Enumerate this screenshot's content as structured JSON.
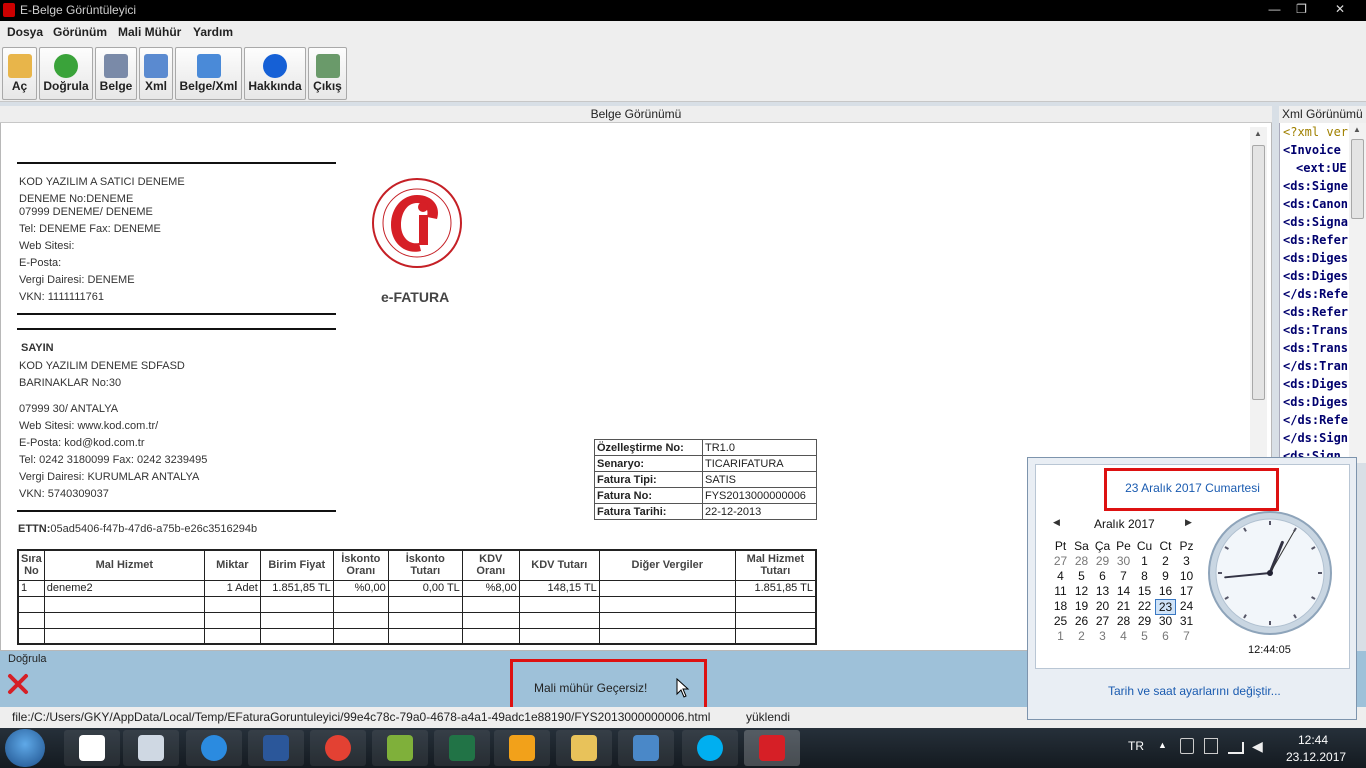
{
  "window": {
    "title": "E-Belge Görüntüleyici",
    "min": "—",
    "max": "❐",
    "close": "✕"
  },
  "menu": [
    "Dosya",
    "Görünüm",
    "Mali Mühür",
    "Yardım"
  ],
  "toolbar": [
    {
      "label": "Aç",
      "icon": "folder-icon",
      "color": "#e8b54a"
    },
    {
      "label": "Doğrula",
      "icon": "check-icon",
      "color": "#3aa33a"
    },
    {
      "label": "Belge",
      "icon": "document-icon",
      "color": "#7a8aa8"
    },
    {
      "label": "Xml",
      "icon": "xml-icon",
      "color": "#5a8ad0"
    },
    {
      "label": "Belge/Xml",
      "icon": "split-view-icon",
      "color": "#4a8ad8"
    },
    {
      "label": "Hakkında",
      "icon": "info-icon",
      "color": "#1560d6"
    },
    {
      "label": "Çıkış",
      "icon": "exit-icon",
      "color": "#6a9a6a"
    }
  ],
  "doc_panel": {
    "title": "Belge Görünümü"
  },
  "xml_panel": {
    "title": "Xml Görünümü",
    "lines": [
      "<?xml vers",
      "<Invoice",
      "<ext:UE",
      "<ds:Signe",
      "<ds:Canon",
      "<ds:Signa",
      "<ds:Refer",
      "<ds:Diges",
      "<ds:Diges",
      "</ds:Refe",
      "<ds:Refer",
      "<ds:Trans",
      "<ds:Trans",
      "</ds:Tran",
      "<ds:Diges",
      "<ds:Diges",
      "</ds:Refe",
      "</ds:Sign",
      "<ds:Sign"
    ]
  },
  "seller": {
    "name": "KOD YAZILIM A SATICI DENEME",
    "addr1": "DENEME  No:DENEME",
    "addr2": "07999 DENEME/ DENEME",
    "tel": "Tel: DENEME Fax: DENEME",
    "web": "Web Sitesi:",
    "email": "E-Posta:",
    "tax_office": "Vergi Dairesi: DENEME",
    "vkn": "VKN: 1111111761"
  },
  "logo_caption": "e-FATURA",
  "buyer": {
    "header": "SAYIN",
    "name": "KOD YAZILIM DENEME SDFASD",
    "addr1": "BARINAKLAR  No:30",
    "addr2": "07999 30/ ANTALYA",
    "web": "Web Sitesi: www.kod.com.tr/",
    "email": "E-Posta: kod@kod.com.tr",
    "tel": "Tel: 0242 3180099 Fax: 0242 3239495",
    "tax_office": "Vergi Dairesi: KURUMLAR ANTALYA",
    "vkn": "VKN: 5740309037"
  },
  "ettn": {
    "label": "ETTN:",
    "value": "05ad5406-f47b-47d6-a75b-e26c3516294b"
  },
  "invoice_info": [
    {
      "label": "Özelleştirme No:",
      "value": "TR1.0"
    },
    {
      "label": "Senaryo:",
      "value": "TICARIFATURA"
    },
    {
      "label": "Fatura Tipi:",
      "value": "SATIS"
    },
    {
      "label": "Fatura No:",
      "value": "FYS2013000000006"
    },
    {
      "label": "Fatura Tarihi:",
      "value": "22-12-2013"
    }
  ],
  "items_table": {
    "headers": [
      "Sıra No",
      "Mal Hizmet",
      "Miktar",
      "Birim Fiyat",
      "İskonto Oranı",
      "İskonto Tutarı",
      "KDV Oranı",
      "KDV Tutarı",
      "Diğer Vergiler",
      "Mal Hizmet Tutarı"
    ],
    "rows": [
      [
        "1",
        "deneme2",
        "1 Adet",
        "1.851,85 TL",
        "%0,00",
        "0,00 TL",
        "%8,00",
        "148,15 TL",
        "",
        "1.851,85 TL"
      ]
    ]
  },
  "status": {
    "label": "Doğrula",
    "message": "Mali mühür Geçersiz!"
  },
  "path": {
    "file": "file:/C:/Users/GKY/AppData/Local/Temp/EFaturaGoruntuleyici/99e4c78c-79a0-4678-a4a1-49adc1e88190/FYS2013000000006.html",
    "state": "yüklendi"
  },
  "calendar": {
    "date_full": "23 Aralık 2017 Cumartesi",
    "month": "Aralık 2017",
    "weekdays": [
      "Pt",
      "Sa",
      "Ça",
      "Pe",
      "Cu",
      "Ct",
      "Pz"
    ],
    "weeks": [
      [
        "27",
        "28",
        "29",
        "30",
        "1",
        "2",
        "3"
      ],
      [
        "4",
        "5",
        "6",
        "7",
        "8",
        "9",
        "10"
      ],
      [
        "11",
        "12",
        "13",
        "14",
        "15",
        "16",
        "17"
      ],
      [
        "18",
        "19",
        "20",
        "21",
        "22",
        "23",
        "24"
      ],
      [
        "25",
        "26",
        "27",
        "28",
        "29",
        "30",
        "31"
      ],
      [
        "1",
        "2",
        "3",
        "4",
        "5",
        "6",
        "7"
      ]
    ],
    "today": "23",
    "time": "12:44:05",
    "clock": {
      "hour": 12,
      "minute": 44,
      "second": 5
    },
    "settings_link": "Tarih ve saat ayarlarını değiştir..."
  },
  "taskbar": {
    "lang": "TR",
    "time": "12:44",
    "date": "23.12.2017",
    "apps": [
      {
        "name": "tiles-app",
        "color": "#ffffff"
      },
      {
        "name": "window-app",
        "color": "#cfd8e3"
      },
      {
        "name": "internet-explorer",
        "color": "#2b8be0"
      },
      {
        "name": "word",
        "color": "#2b579a"
      },
      {
        "name": "chrome",
        "color": "#e34133"
      },
      {
        "name": "notepad-plus",
        "color": "#7fb03a"
      },
      {
        "name": "excel",
        "color": "#217346"
      },
      {
        "name": "ribbon-app",
        "color": "#f2a11a"
      },
      {
        "name": "file-explorer",
        "color": "#e8c25a"
      },
      {
        "name": "remote-app",
        "color": "#4a88c8"
      },
      {
        "name": "skype",
        "color": "#00aff0"
      },
      {
        "name": "e-belge",
        "color": "#d61f26"
      }
    ]
  }
}
